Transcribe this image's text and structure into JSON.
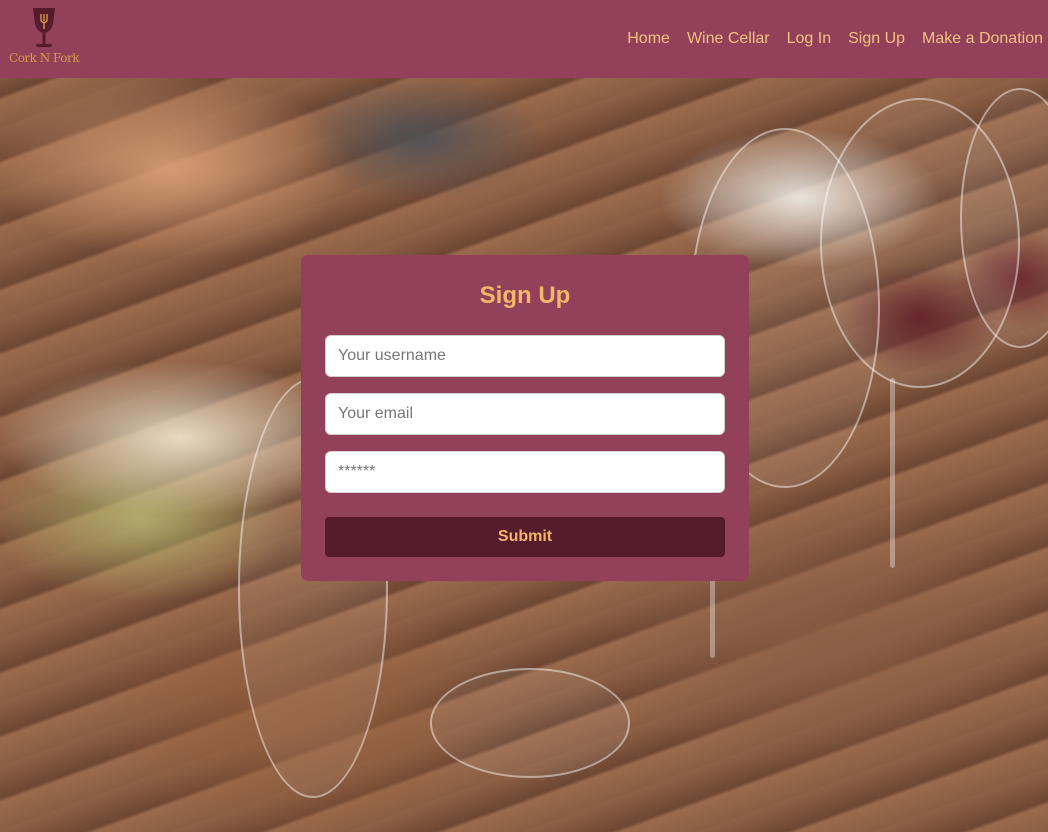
{
  "brand": {
    "logo_text": "Cork N Fork",
    "logo_icon": "wine-glass-fork-icon"
  },
  "nav": {
    "items": [
      {
        "label": "Home"
      },
      {
        "label": "Wine Cellar"
      },
      {
        "label": "Log In"
      },
      {
        "label": "Sign Up"
      },
      {
        "label": "Make a Donation"
      }
    ]
  },
  "signup": {
    "title": "Sign Up",
    "username": {
      "value": "",
      "placeholder": "Your username"
    },
    "email": {
      "value": "",
      "placeholder": "Your email"
    },
    "password": {
      "value": "",
      "placeholder": "******"
    },
    "submit_label": "Submit"
  },
  "colors": {
    "navbar_bg": "#93405a",
    "nav_text": "#f2c27e",
    "panel_bg": "#93405a",
    "title_text": "#f2b769",
    "button_bg": "#561c2e",
    "button_text": "#f2b769"
  }
}
